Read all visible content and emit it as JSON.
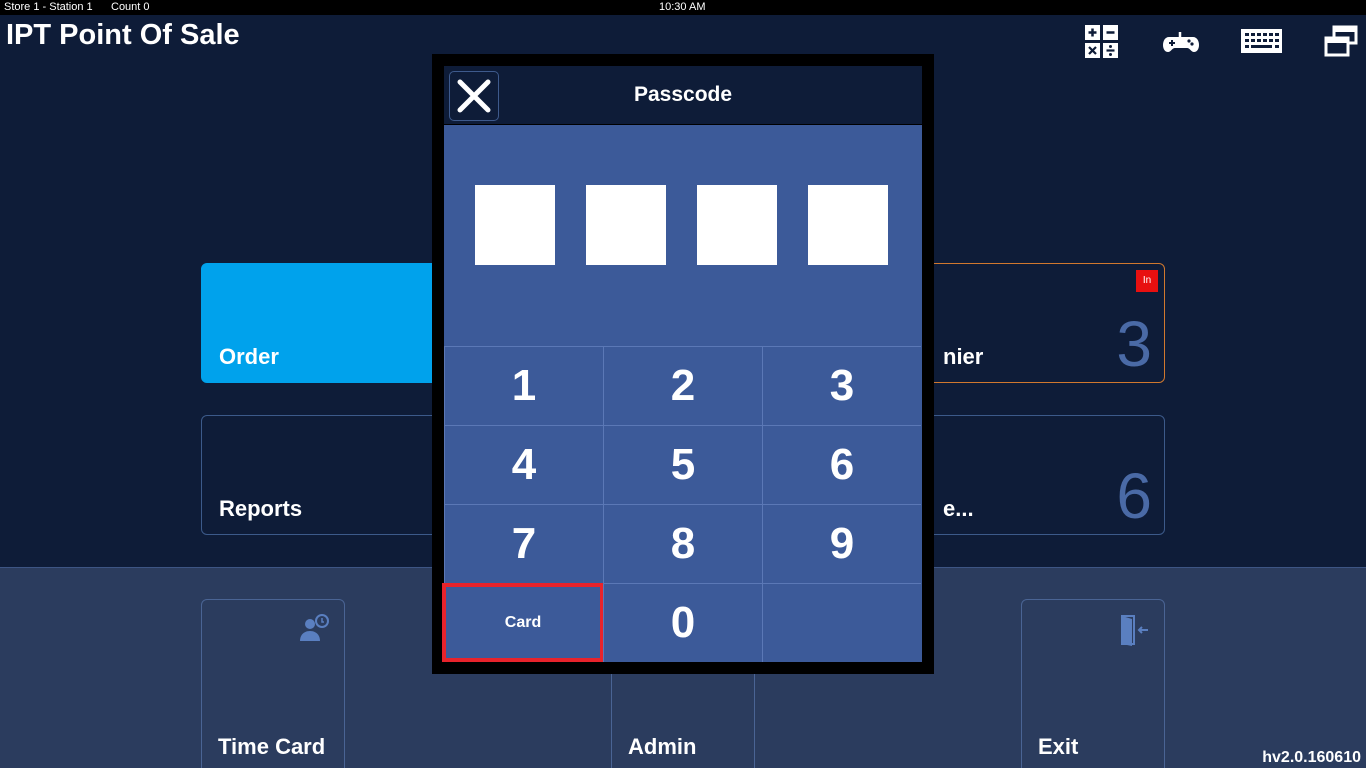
{
  "status_bar": {
    "store": "Store 1 - Station 1",
    "count": "Count 0",
    "time": "10:30 AM"
  },
  "app_title": "IPT Point Of Sale",
  "toolbar": {
    "icons": [
      "calculator-icon",
      "gamepad-icon",
      "keyboard-icon",
      "restore-window-icon"
    ]
  },
  "tiles": {
    "order": {
      "label": "Order"
    },
    "reports": {
      "label": "Reports"
    },
    "cashier": {
      "label": "nier",
      "number": "3",
      "badge": "In"
    },
    "more": {
      "label": "e...",
      "number": "6"
    }
  },
  "bottom_tiles": {
    "timecard": {
      "label": "Time Card",
      "icon": "user-clock-icon"
    },
    "admin": {
      "label": "Admin"
    },
    "exit": {
      "label": "Exit",
      "icon": "door-exit-icon"
    }
  },
  "version": "hv2.0.160610",
  "passcode_dialog": {
    "title": "Passcode",
    "close_icon": "close-icon",
    "digits": [
      "",
      "",
      "",
      ""
    ],
    "keys": [
      "1",
      "2",
      "3",
      "4",
      "5",
      "6",
      "7",
      "8",
      "9",
      "Card",
      "0",
      ""
    ]
  },
  "colors": {
    "background": "#0e1c38",
    "order_tile": "#00a2ec",
    "dialog_body": "#3c5a99",
    "highlight": "#e8232b",
    "badge": "#e81010"
  }
}
